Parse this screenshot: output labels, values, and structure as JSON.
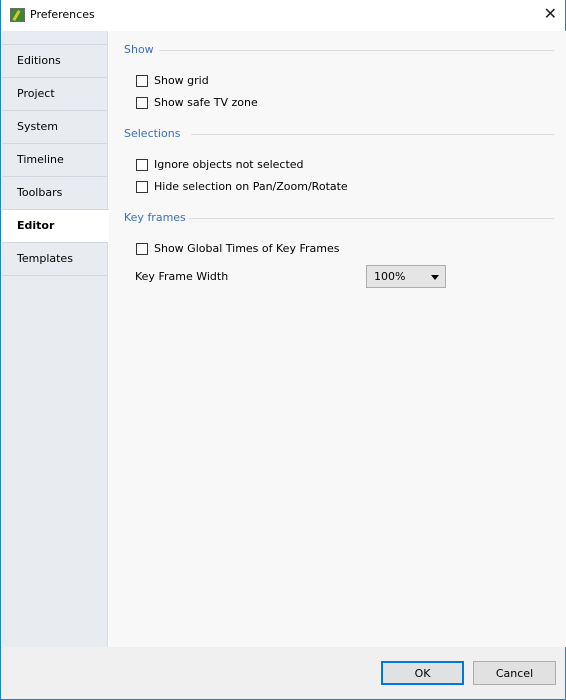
{
  "window": {
    "title": "Preferences",
    "close_icon": "close-icon",
    "app_icon": "app-icon"
  },
  "sidebar": {
    "items": [
      {
        "label": "Editions"
      },
      {
        "label": "Project"
      },
      {
        "label": "System"
      },
      {
        "label": "Timeline"
      },
      {
        "label": "Toolbars"
      },
      {
        "label": "Editor",
        "active": true
      },
      {
        "label": "Templates"
      }
    ]
  },
  "main": {
    "show": {
      "title": "Show",
      "show_grid": "Show grid",
      "show_safe_tv": "Show safe TV zone"
    },
    "selections": {
      "title": "Selections",
      "ignore": "Ignore objects not selected",
      "hide": "Hide selection on Pan/Zoom/Rotate"
    },
    "keyframes": {
      "title": "Key frames",
      "show_global": "Show Global Times of Key Frames",
      "width_label": "Key Frame Width",
      "width_value": "100%"
    }
  },
  "footer": {
    "ok": "OK",
    "cancel": "Cancel"
  },
  "colors": {
    "accent": "#0078d7",
    "section": "#3b6fb6",
    "sidebar": "#e8ebf0"
  }
}
